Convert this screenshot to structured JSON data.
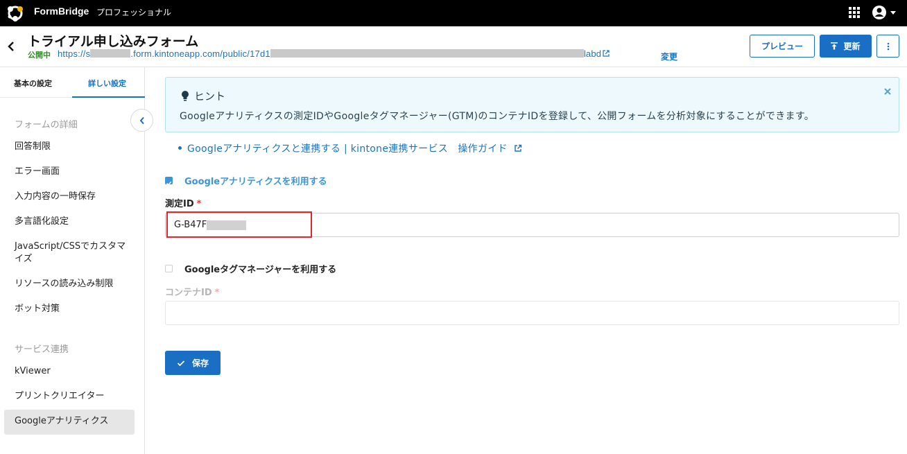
{
  "app": {
    "brand": "FormBridge",
    "plan": "プロフェッショナル"
  },
  "header": {
    "title": "トライアル申し込みフォーム",
    "status": "公開中",
    "url_prefix": "https://s",
    "url_middle": ".form.kintoneapp.com/public/17d1",
    "url_suffix": "labd",
    "change_label": "変更",
    "preview_label": "プレビュー",
    "update_label": "更新"
  },
  "sidebar": {
    "tab_basic": "基本の設定",
    "tab_detail": "詳しい設定",
    "section_form": "フォームの詳細",
    "items": [
      "回答制限",
      "エラー画面",
      "入力内容の一時保存",
      "多言語化設定",
      "JavaScript/CSSでカスタマイズ",
      "リソースの読み込み制限",
      "ボット対策"
    ],
    "section_service": "サービス連携",
    "service_items": [
      "kViewer",
      "プリントクリエイター",
      "Googleアナリティクス"
    ]
  },
  "hint": {
    "title": "ヒント",
    "text": "Googleアナリティクスの測定IDやGoogleタグマネージャー(GTM)のコンテナIDを登録して、公開フォームを分析対象にすることができます。"
  },
  "guide_link": "Googleアナリティクスと連携する | kintone連携サービス　操作ガイド",
  "ga": {
    "checkbox_label": "Googleアナリティクスを利用する",
    "checked": true,
    "field_label": "測定ID",
    "value": "G-B47F"
  },
  "gtm": {
    "checkbox_label": "Googleタグマネージャーを利用する",
    "checked": false,
    "field_label": "コンテナID",
    "value": ""
  },
  "save_label": "保存",
  "colors": {
    "accent": "#1a6fc4",
    "highlight": "#e2262c",
    "status": "#2e8b22"
  }
}
